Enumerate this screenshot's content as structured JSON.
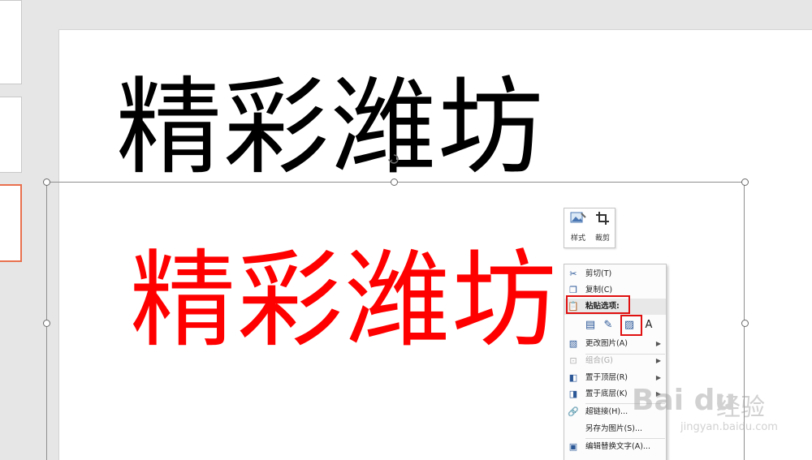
{
  "slide": {
    "title_black": "精彩潍坊",
    "title_red": "精彩潍坊"
  },
  "mini_toolbar": {
    "style_label": "样式",
    "crop_label": "裁剪",
    "style_icon": "picture-style-icon",
    "crop_icon": "crop-icon"
  },
  "context_menu": {
    "cut": "剪切(T)",
    "copy": "复制(C)",
    "paste_options": "粘贴选项:",
    "change_picture": "更改图片(A)",
    "group": "组合(G)",
    "bring_to_front": "置于顶层(R)",
    "send_to_back": "置于底层(K)",
    "hyperlink": "超链接(H)...",
    "save_as_picture": "另存为图片(S)...",
    "edit_alt_text": "编辑替换文字(A)..."
  },
  "watermark": {
    "logo": "Bai du",
    "chinese": "经验",
    "url": "jingyan.baidu.com"
  },
  "colors": {
    "highlight": "#e01010",
    "red_text": "#ff0000",
    "thumb_selected": "#e8704e"
  }
}
